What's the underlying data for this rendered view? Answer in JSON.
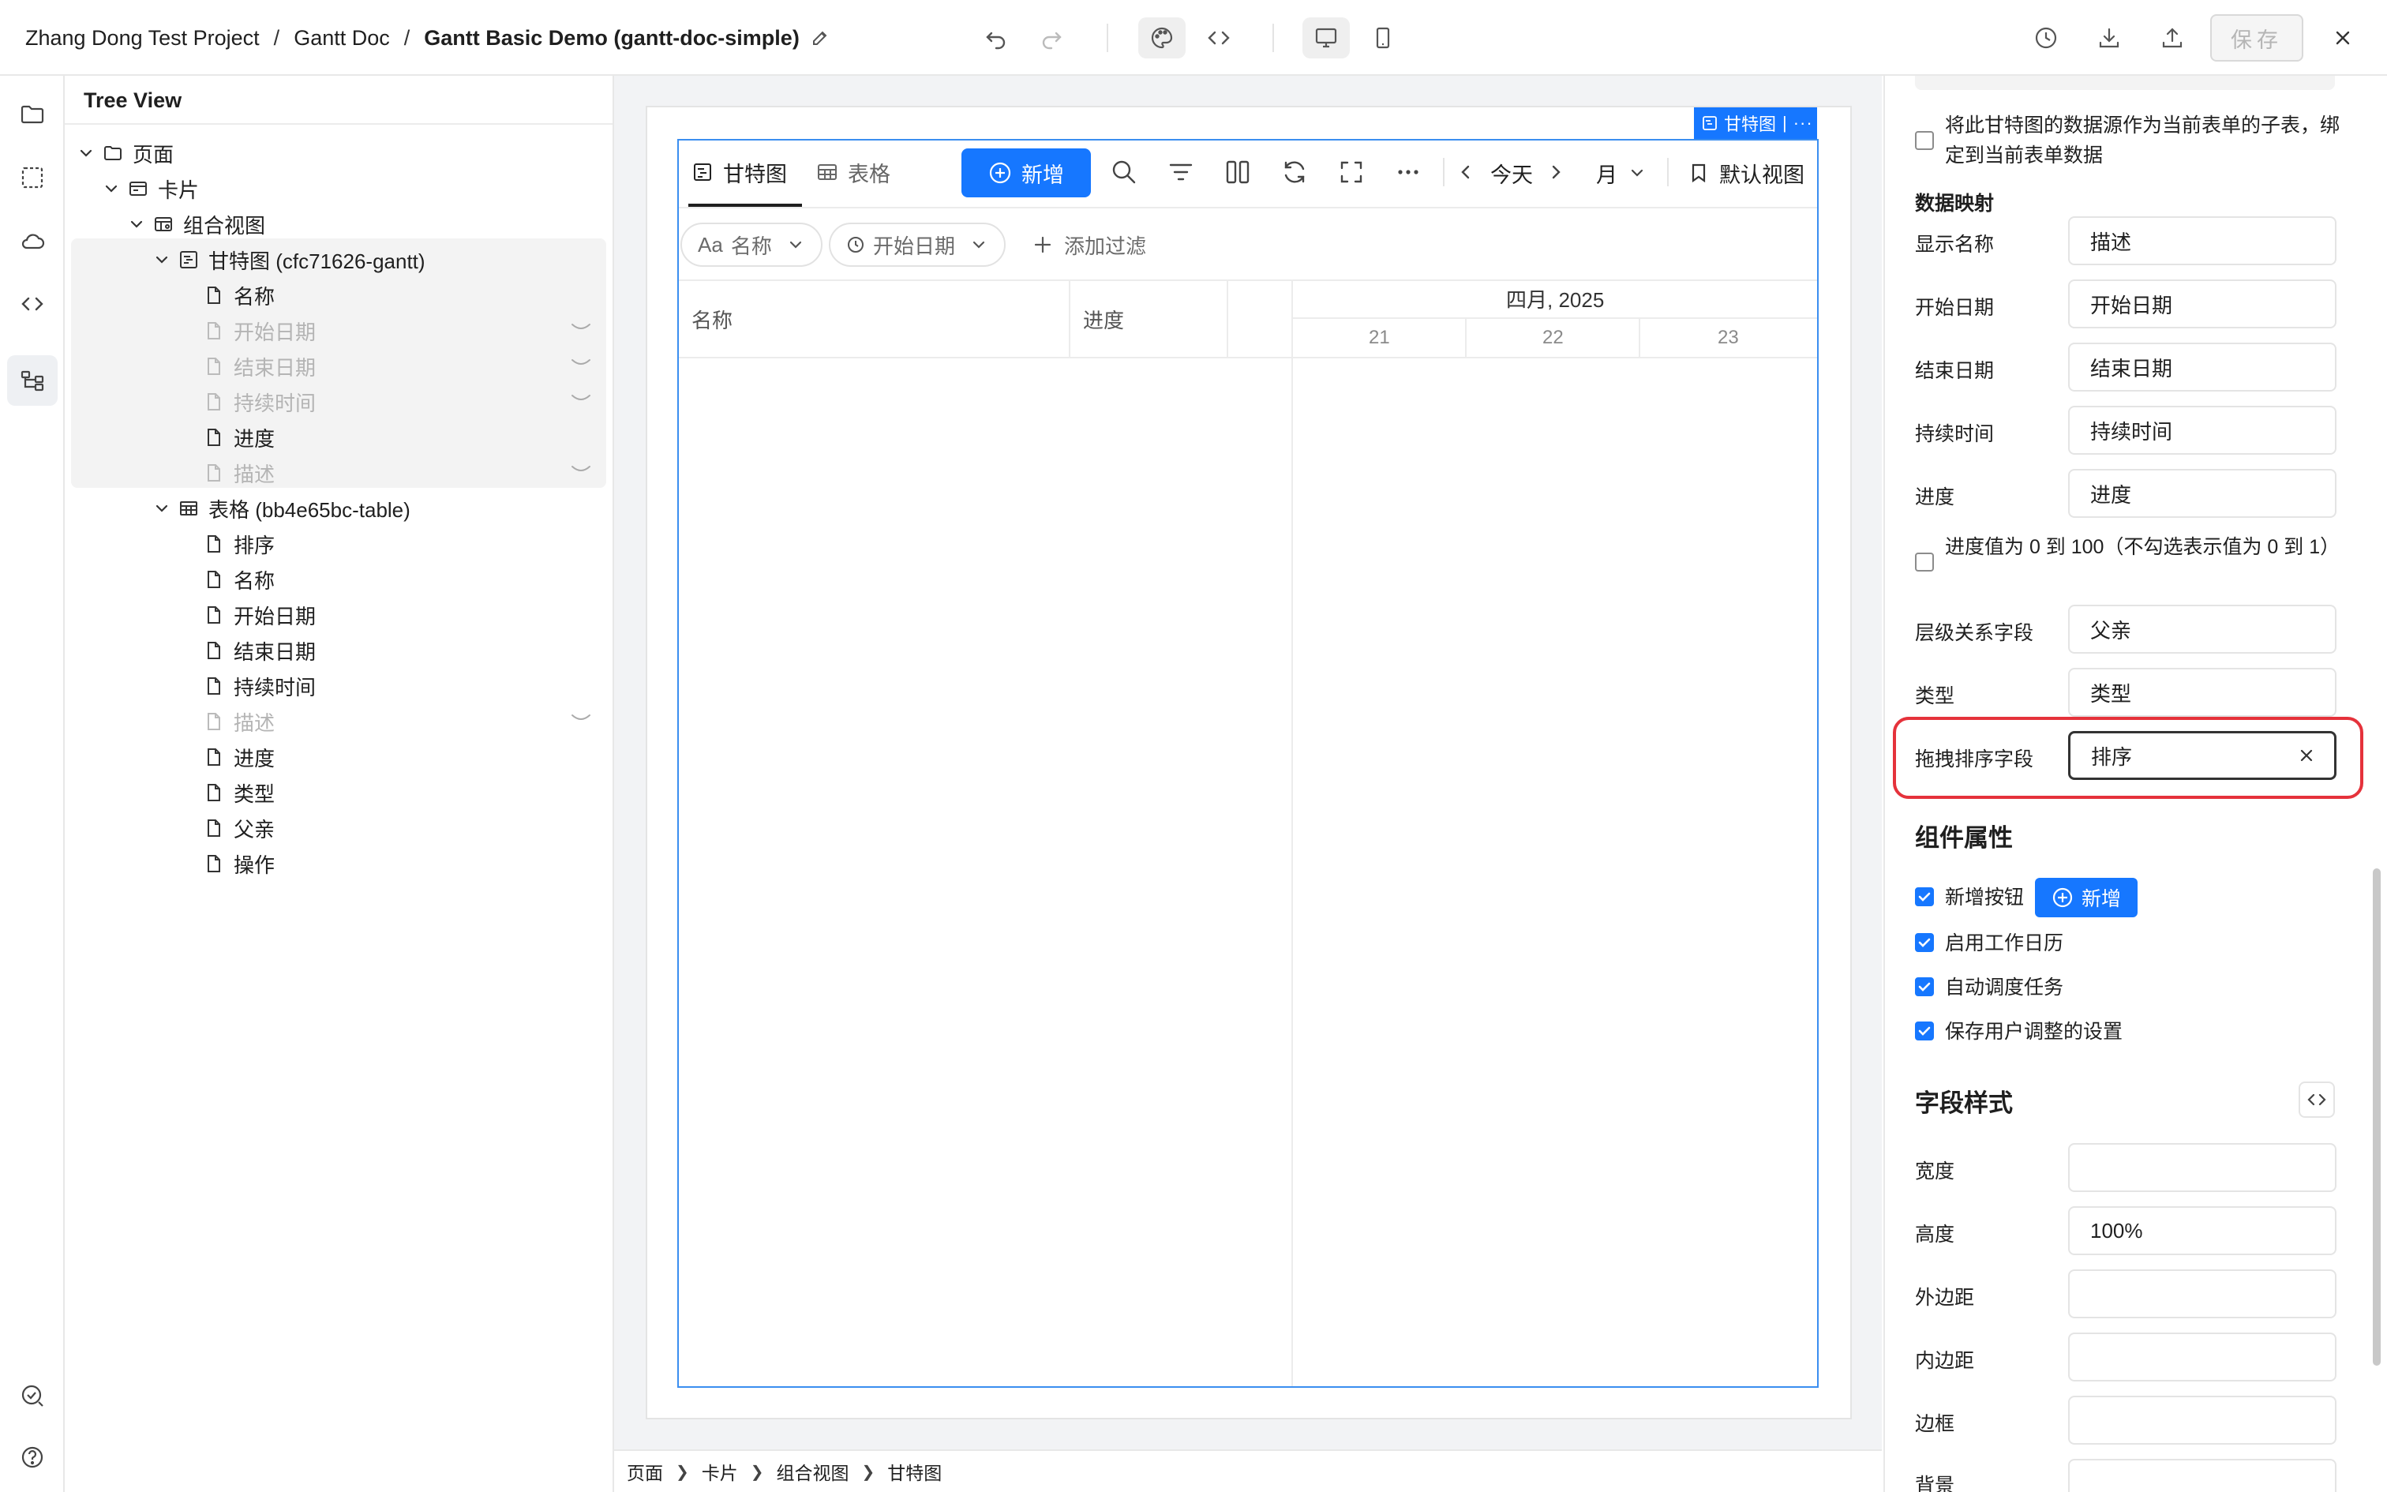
{
  "header": {
    "breadcrumb": [
      "Zhang Dong Test Project",
      "Gantt Doc",
      "Gantt Basic Demo (gantt-doc-simple)"
    ],
    "separator": "/",
    "save_label": "保存"
  },
  "tree": {
    "title": "Tree View",
    "items": [
      {
        "label": "页面",
        "icon": "folder-icon",
        "level": 0,
        "expanded": true
      },
      {
        "label": "卡片",
        "icon": "card-icon",
        "level": 1,
        "expanded": true
      },
      {
        "label": "组合视图",
        "icon": "combo-view-icon",
        "level": 2,
        "expanded": true
      },
      {
        "label": "甘特图 (cfc71626-gantt)",
        "icon": "gantt-icon",
        "level": 3,
        "expanded": true
      },
      {
        "label": "名称",
        "icon": "file-icon",
        "level": 4
      },
      {
        "label": "开始日期",
        "icon": "file-icon",
        "level": 4,
        "hidden": true
      },
      {
        "label": "结束日期",
        "icon": "file-icon",
        "level": 4,
        "hidden": true
      },
      {
        "label": "持续时间",
        "icon": "file-icon",
        "level": 4,
        "hidden": true
      },
      {
        "label": "进度",
        "icon": "file-icon",
        "level": 4
      },
      {
        "label": "描述",
        "icon": "file-icon",
        "level": 4,
        "hidden": true
      },
      {
        "label": "表格 (bb4e65bc-table)",
        "icon": "table-icon",
        "level": 3,
        "expanded": true
      },
      {
        "label": "排序",
        "icon": "file-icon",
        "level": 4
      },
      {
        "label": "名称",
        "icon": "file-icon",
        "level": 4
      },
      {
        "label": "开始日期",
        "icon": "file-icon",
        "level": 4
      },
      {
        "label": "结束日期",
        "icon": "file-icon",
        "level": 4
      },
      {
        "label": "持续时间",
        "icon": "file-icon",
        "level": 4
      },
      {
        "label": "描述",
        "icon": "file-icon",
        "level": 4,
        "hidden": true
      },
      {
        "label": "进度",
        "icon": "file-icon",
        "level": 4
      },
      {
        "label": "类型",
        "icon": "file-icon",
        "level": 4
      },
      {
        "label": "父亲",
        "icon": "file-icon",
        "level": 4
      },
      {
        "label": "操作",
        "icon": "file-icon",
        "level": 4
      }
    ]
  },
  "gantt": {
    "tag_label": "甘特图",
    "tabs": [
      {
        "label": "甘特图",
        "icon": "gantt-icon",
        "active": true
      },
      {
        "label": "表格",
        "icon": "table-icon",
        "active": false
      }
    ],
    "add_label": "新增",
    "today_label": "今天",
    "scale_label": "月",
    "view_label": "默认视图",
    "filters": [
      {
        "label": "名称",
        "prefix": "Aa"
      },
      {
        "label": "开始日期",
        "icon": "clock-icon"
      }
    ],
    "add_filter_label": "添加过滤",
    "columns": [
      "名称",
      "进度"
    ],
    "month_label": "四月, 2025",
    "days": [
      "21",
      "22",
      "23"
    ]
  },
  "props": {
    "subtable_checkbox": {
      "label": "将此甘特图的数据源作为当前表单的子表，绑定到当前表单数据",
      "checked": false
    },
    "mapping_title": "数据映射",
    "mappings": [
      {
        "label": "显示名称",
        "value": "描述"
      },
      {
        "label": "开始日期",
        "value": "开始日期"
      },
      {
        "label": "结束日期",
        "value": "结束日期"
      },
      {
        "label": "持续时间",
        "value": "持续时间"
      },
      {
        "label": "进度",
        "value": "进度"
      }
    ],
    "progress_checkbox": {
      "label": "进度值为 0 到 100（不勾选表示值为 0 到 1）",
      "checked": false
    },
    "mappings2": [
      {
        "label": "层级关系字段",
        "value": "父亲"
      },
      {
        "label": "类型",
        "value": "类型"
      }
    ],
    "sort_field": {
      "label": "拖拽排序字段",
      "value": "排序"
    },
    "component_title": "组件属性",
    "component_checks": [
      {
        "label": "新增按钮",
        "checked": true
      },
      {
        "label": "启用工作日历",
        "checked": true
      },
      {
        "label": "自动调度任务",
        "checked": true
      },
      {
        "label": "保存用户调整的设置",
        "checked": true
      }
    ],
    "mini_add_label": "新增",
    "style_title": "字段样式",
    "style_fields": [
      {
        "label": "宽度",
        "value": ""
      },
      {
        "label": "高度",
        "value": "100%"
      },
      {
        "label": "外边距",
        "value": ""
      },
      {
        "label": "内边距",
        "value": ""
      },
      {
        "label": "边框",
        "value": ""
      },
      {
        "label": "背景",
        "value": ""
      }
    ]
  },
  "bottom_breadcrumb": [
    "页面",
    "卡片",
    "组合视图",
    "甘特图"
  ],
  "colors": {
    "accent": "#1677ff",
    "highlight": "#e5323b"
  }
}
